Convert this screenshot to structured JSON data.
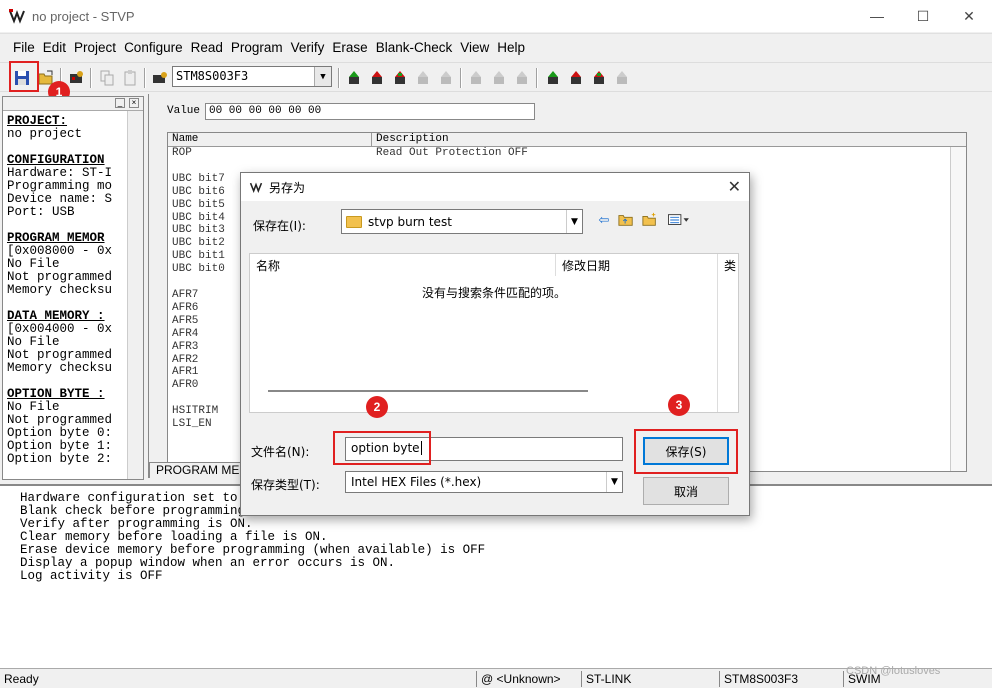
{
  "window": {
    "title": "no project - STVP",
    "min": "—",
    "max": "☐",
    "close": "✕"
  },
  "menu": [
    "File",
    "Edit",
    "Project",
    "Configure",
    "Read",
    "Program",
    "Verify",
    "Erase",
    "Blank-Check",
    "View",
    "Help"
  ],
  "toolbar": {
    "device": "STM8S003F3"
  },
  "badges": [
    "1",
    "2",
    "3"
  ],
  "left_panel": {
    "lines": [
      {
        "t": "PROJECT:",
        "h": true
      },
      {
        "t": "no project",
        "h": false
      },
      {
        "t": "",
        "h": false
      },
      {
        "t": "CONFIGURATION",
        "h": true
      },
      {
        "t": "Hardware: ST-I",
        "h": false
      },
      {
        "t": "Programming mo",
        "h": false
      },
      {
        "t": "Device name: S",
        "h": false
      },
      {
        "t": "Port: USB",
        "h": false
      },
      {
        "t": "",
        "h": false
      },
      {
        "t": "PROGRAM MEMOR",
        "h": true
      },
      {
        "t": "[0x008000 - 0x",
        "h": false
      },
      {
        "t": "No File",
        "h": false
      },
      {
        "t": "Not programmed",
        "h": false
      },
      {
        "t": "Memory checksu",
        "h": false
      },
      {
        "t": "",
        "h": false
      },
      {
        "t": "DATA MEMORY :",
        "h": true
      },
      {
        "t": "[0x004000 - 0x",
        "h": false
      },
      {
        "t": "No File",
        "h": false
      },
      {
        "t": "Not programmed",
        "h": false
      },
      {
        "t": "Memory checksu",
        "h": false
      },
      {
        "t": "",
        "h": false
      },
      {
        "t": "OPTION BYTE :",
        "h": true
      },
      {
        "t": "No File",
        "h": false
      },
      {
        "t": "Not programmed",
        "h": false
      },
      {
        "t": "Option byte 0:",
        "h": false
      },
      {
        "t": "Option byte 1:",
        "h": false
      },
      {
        "t": "Option byte 2:",
        "h": false
      }
    ]
  },
  "main": {
    "value_label": "Value",
    "value": "00 00 00 00 00 00",
    "col_name": "Name",
    "col_desc": "Description",
    "names": "ROP\n\nUBC bit7\nUBC bit6\nUBC bit5\nUBC bit4\nUBC bit3\nUBC bit2\nUBC bit1\nUBC bit0\n\nAFR7\nAFR6\nAFR5\nAFR4\nAFR3\nAFR2\nAFR1\nAFR0\n\nHSITRIM\nLSI_EN",
    "first_desc": "Read Out Protection OFF",
    "tab": "PROGRAM ME"
  },
  "log": {
    "lines": [
      "Hardware configuration set to",
      "Blank check before programming",
      "Verify after programming is ON.",
      "Clear memory before loading a file is ON.",
      "Erase device memory before programming (when available) is OFF",
      "Display a popup window when an error occurs is ON.",
      "Log activity is OFF"
    ]
  },
  "status": {
    "ready": "Ready",
    "port": "@ <Unknown>",
    "hw": "ST-LINK",
    "device": "STM8S003F3",
    "mode": "SWIM",
    "watermark": "CSDN @lotusloves"
  },
  "dialog": {
    "title": "另存为",
    "save_in_label": "保存在(I):",
    "save_in_value": "stvp burn test",
    "col_name": "名称",
    "col_date": "修改日期",
    "col_type": "类",
    "empty_message": "没有与搜索条件匹配的项。",
    "filename_label": "文件名(N):",
    "filename_value": "option byte",
    "filetype_label": "保存类型(T):",
    "filetype_value": "Intel HEX Files (*.hex)",
    "save_button": "保存(S)",
    "cancel_button": "取消"
  },
  "colors": {
    "highlight": "#e02020",
    "accent_green": "#1a9a1a",
    "accent_red": "#cc1111"
  }
}
